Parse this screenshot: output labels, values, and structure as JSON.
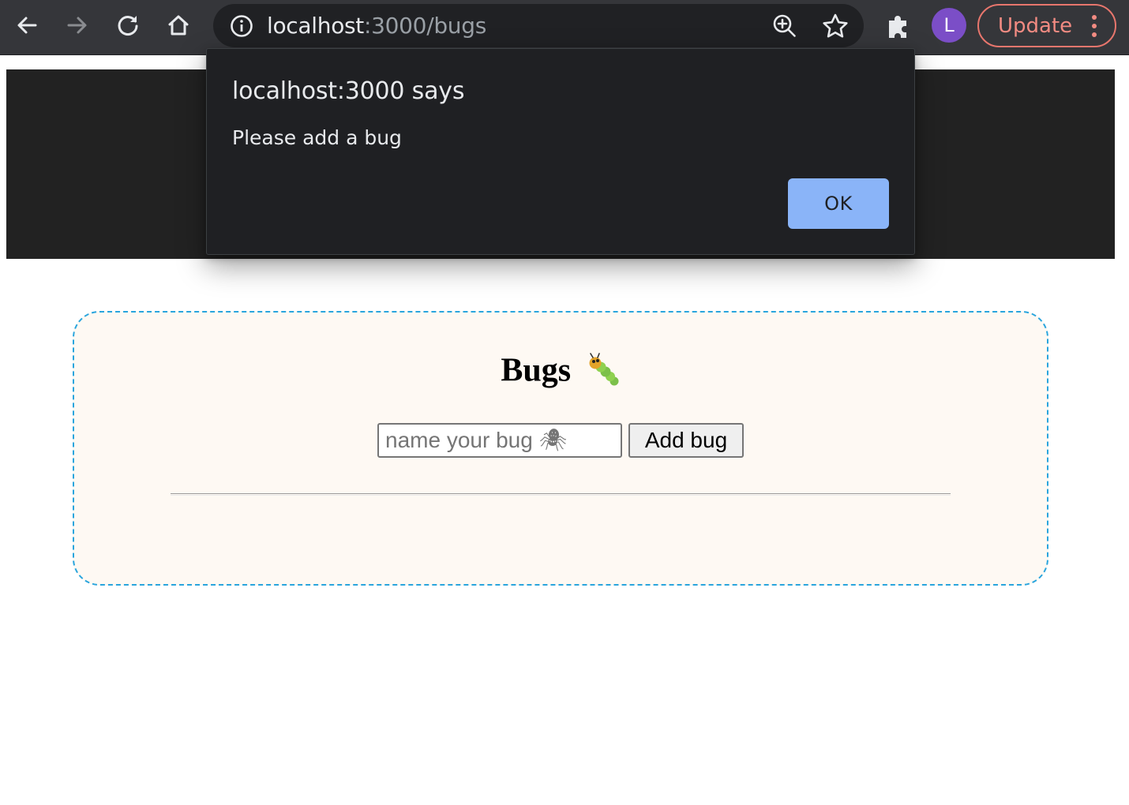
{
  "browser": {
    "url_host": "localhost",
    "url_rest": ":3000/bugs",
    "profile_initial": "L",
    "update_label": "Update",
    "icons": [
      "back-arrow-icon",
      "forward-arrow-icon",
      "reload-icon",
      "home-icon",
      "info-icon",
      "zoom-icon",
      "star-icon",
      "puzzle-icon",
      "kebab-menu-icon"
    ],
    "colors": {
      "toolbar": "#35363a",
      "omnibox": "#202124",
      "avatar": "#7b4ec7",
      "update_accent": "#f28b82"
    }
  },
  "page": {
    "title": "Bugs",
    "title_icon": "caterpillar-icon",
    "input_placeholder": "name your bug 🕷",
    "input_value": "",
    "add_button_label": "Add bug",
    "colors": {
      "header": "#222222",
      "card_bg": "#fef9f3",
      "card_border": "#2aa5dd"
    }
  },
  "alert": {
    "title": "localhost:3000 says",
    "message": "Please add a bug",
    "ok_label": "OK",
    "colors": {
      "background": "#1f2023",
      "ok_button": "#8ab4f8"
    }
  }
}
